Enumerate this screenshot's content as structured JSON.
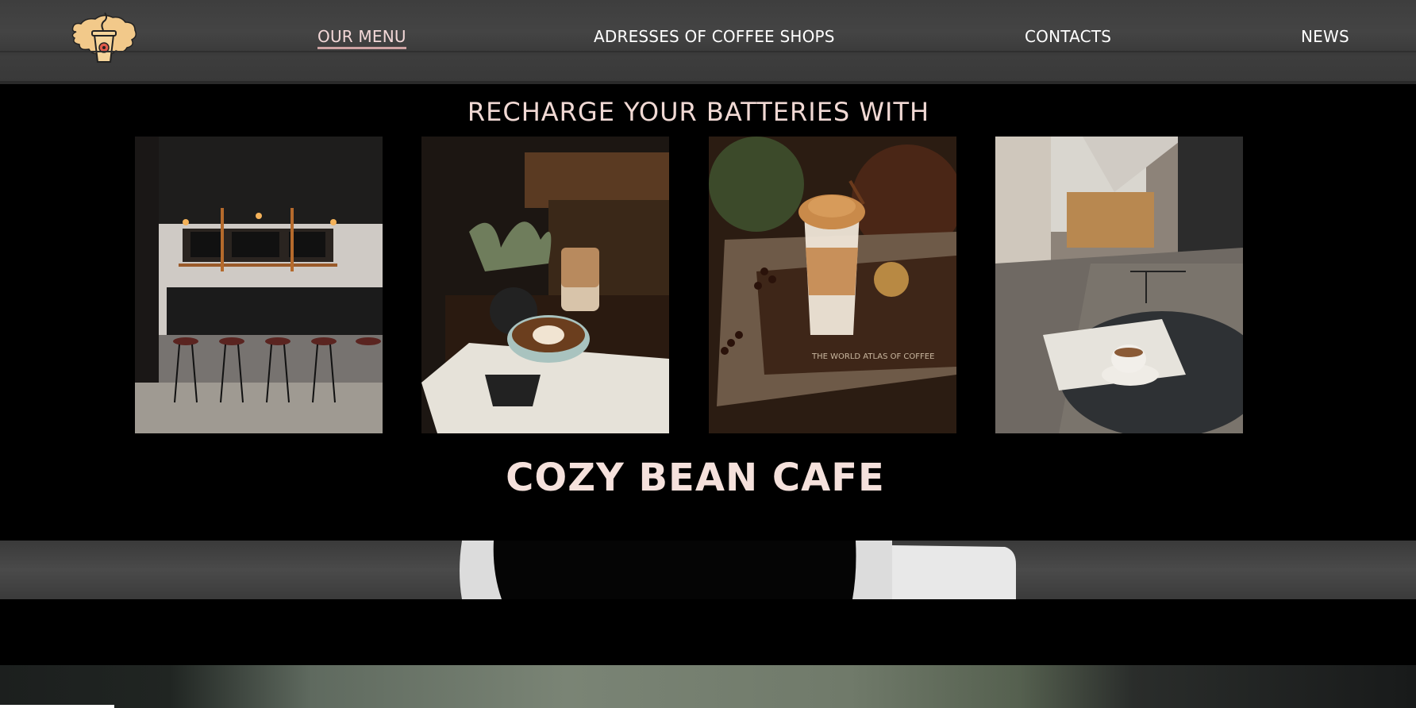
{
  "nav": {
    "items": [
      {
        "label": "OUR MENU",
        "active": true
      },
      {
        "label": "ADRESSES OF COFFEE SHOPS",
        "active": false
      },
      {
        "label": "CONTACTS",
        "active": false
      },
      {
        "label": "NEWS",
        "active": false
      }
    ],
    "logo_icon": "coffee-cup-logo-icon"
  },
  "hero": {
    "tagline": "RECHARGE YOUR BATTERIES WITH",
    "cafe_name": "COZY BEAN CAFE",
    "photos": [
      {
        "name": "cafe-interior-photo"
      },
      {
        "name": "latte-art-photo"
      },
      {
        "name": "dalgona-coffee-photo"
      },
      {
        "name": "street-cafe-photo"
      }
    ]
  },
  "colors": {
    "header_bg": "#3e3e3e",
    "accent_text": "#f1d9d4",
    "active_underline": "#cfa3a3",
    "page_bg": "#000000"
  }
}
